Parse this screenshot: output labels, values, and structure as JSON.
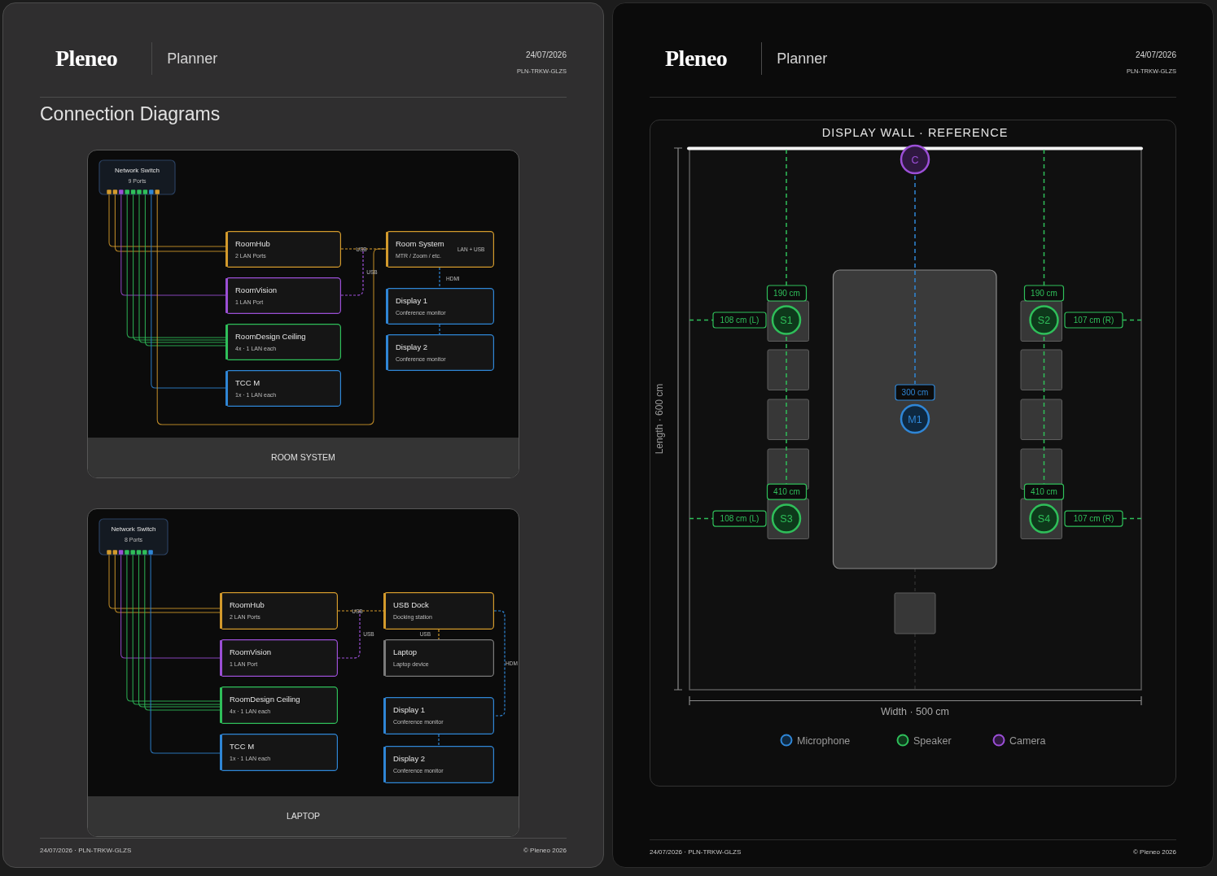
{
  "pages": [
    {
      "kind": "diagrams",
      "brand": "Pleneo",
      "app": "Planner",
      "date": "24/07/2026",
      "code": "PLN-TRKW-GLZS",
      "title": "Connection Diagrams",
      "diagrams": [
        {
          "caption": "ROOM SYSTEM",
          "switch": {
            "name": "Network Switch",
            "ports_label": "9 Ports",
            "ports": [
              {
                "color": "#d39a2c"
              },
              {
                "color": "#d39a2c"
              },
              {
                "color": "#9b4fd6"
              },
              {
                "color": "#2fbf5a"
              },
              {
                "color": "#2fbf5a"
              },
              {
                "color": "#2fbf5a"
              },
              {
                "color": "#2fbf5a"
              },
              {
                "color": "#2f86d6"
              },
              {
                "color": "#d39a2c"
              }
            ]
          },
          "devices": [
            {
              "name": "RoomHub",
              "detail": "2 LAN Ports",
              "color": "#d39a2c"
            },
            {
              "name": "RoomVision",
              "detail": "1 LAN Port",
              "color": "#9b4fd6"
            },
            {
              "name": "RoomDesign Ceiling",
              "detail": "4x · 1 LAN each",
              "color": "#2fbf5a"
            },
            {
              "name": "TCC M",
              "detail": "1x · 1 LAN each",
              "color": "#2f86d6"
            },
            {
              "name": "Room System",
              "detail": "MTR / Zoom / etc.",
              "color": "#d39a2c"
            },
            {
              "name": "Display 1",
              "detail": "Conference monitor",
              "color": "#2f86d6"
            },
            {
              "name": "Display 2",
              "detail": "Conference monitor",
              "color": "#2f86d6"
            }
          ],
          "links": [
            {
              "label": "USB"
            },
            {
              "label": "USB"
            },
            {
              "label": "HDMI"
            },
            {
              "label": "LAN + USB"
            }
          ]
        },
        {
          "caption": "LAPTOP",
          "switch": {
            "name": "Network Switch",
            "ports_label": "8 Ports",
            "ports": [
              {
                "color": "#d39a2c"
              },
              {
                "color": "#d39a2c"
              },
              {
                "color": "#9b4fd6"
              },
              {
                "color": "#2fbf5a"
              },
              {
                "color": "#2fbf5a"
              },
              {
                "color": "#2fbf5a"
              },
              {
                "color": "#2fbf5a"
              },
              {
                "color": "#2f86d6"
              }
            ]
          },
          "devices": [
            {
              "name": "RoomHub",
              "detail": "2 LAN Ports",
              "color": "#d39a2c"
            },
            {
              "name": "RoomVision",
              "detail": "1 LAN Port",
              "color": "#9b4fd6"
            },
            {
              "name": "RoomDesign Ceiling",
              "detail": "4x · 1 LAN each",
              "color": "#2fbf5a"
            },
            {
              "name": "TCC M",
              "detail": "1x · 1 LAN each",
              "color": "#2f86d6"
            },
            {
              "name": "USB Dock",
              "detail": "Docking station",
              "color": "#d39a2c"
            },
            {
              "name": "Laptop",
              "detail": "Laptop device",
              "color": "#7a7a7a"
            },
            {
              "name": "Display 1",
              "detail": "Conference monitor",
              "color": "#2f86d6"
            },
            {
              "name": "Display 2",
              "detail": "Conference monitor",
              "color": "#2f86d6"
            }
          ],
          "links": [
            {
              "label": "USB"
            },
            {
              "label": "USB"
            },
            {
              "label": "USB"
            },
            {
              "label": "HDM"
            }
          ]
        }
      ],
      "footer": {
        "left": "24/07/2026 · PLN-TRKW-GLZS",
        "right": "© Pleneo 2026"
      }
    },
    {
      "kind": "layout",
      "brand": "Pleneo",
      "app": "Planner",
      "date": "24/07/2026",
      "code": "PLN-TRKW-GLZS",
      "panel": {
        "title": "DISPLAY WALL · REFERENCE",
        "length_label": "Length · 600 cm",
        "width_label": "Width · 500 cm",
        "devices": [
          {
            "kind": "camera",
            "label": "C"
          },
          {
            "kind": "microphone",
            "label": "M1",
            "distance": "300 cm"
          },
          {
            "kind": "speaker",
            "label": "S1",
            "distance": "190 cm",
            "side_distance": "108 cm (L)"
          },
          {
            "kind": "speaker",
            "label": "S2",
            "distance": "190 cm",
            "side_distance": "107 cm (R)"
          },
          {
            "kind": "speaker",
            "label": "S3",
            "distance": "410 cm",
            "side_distance": "108 cm (L)"
          },
          {
            "kind": "speaker",
            "label": "S4",
            "distance": "410 cm",
            "side_distance": "107 cm (R)"
          }
        ],
        "legend": [
          {
            "kind": "microphone",
            "label": "Microphone",
            "color": "#2f86d6"
          },
          {
            "kind": "speaker",
            "label": "Speaker",
            "color": "#2fbf5a"
          },
          {
            "kind": "camera",
            "label": "Camera",
            "color": "#9b4fd6"
          }
        ]
      },
      "footer": {
        "left": "24/07/2026 · PLN-TRKW-GLZS",
        "right": "© Pleneo 2026"
      }
    }
  ]
}
